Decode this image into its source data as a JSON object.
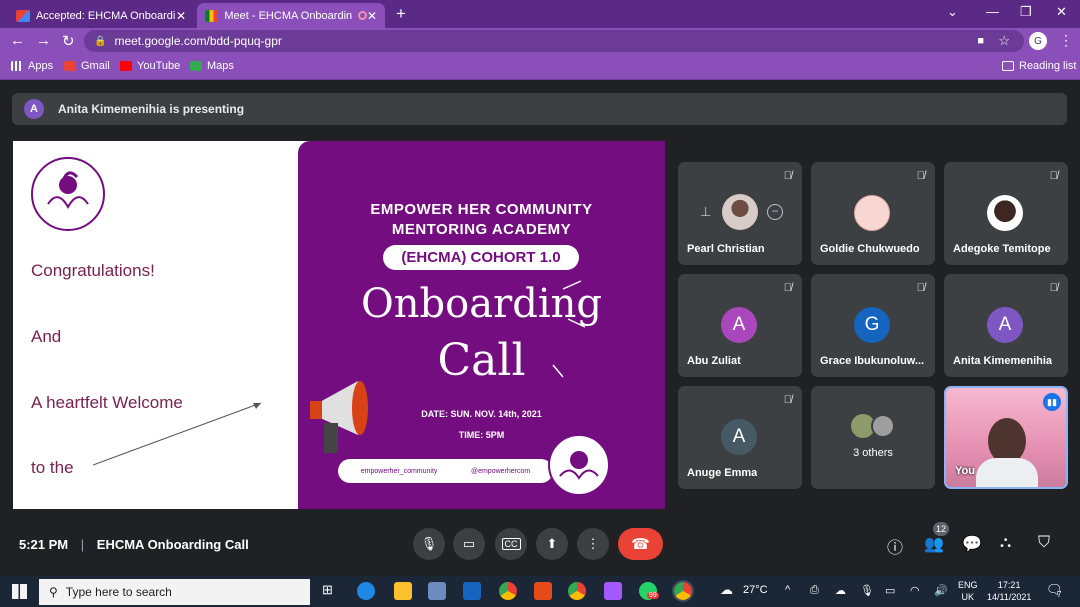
{
  "browser": {
    "tabs": [
      {
        "title": "Accepted: EHCMA Onboarding C",
        "favicon": "gmail-icon"
      },
      {
        "title": "Meet - EHCMA Onboarding",
        "favicon": "meet-icon"
      }
    ],
    "url": "meet.google.com/bdd-pquq-gpr",
    "bookmarks": [
      "Apps",
      "Gmail",
      "YouTube",
      "Maps"
    ],
    "reading_list": "Reading list",
    "profile_initial": "G"
  },
  "presenting": {
    "initial": "A",
    "text": "Anita Kimemenihia is presenting"
  },
  "slide": {
    "left_lines": [
      "Congratulations!",
      "And",
      "A heartfelt Welcome",
      "to the"
    ],
    "logo_text": "EMPOWER HER COMMUNITY",
    "poster_title_1": "EMPOWER HER COMMUNITY",
    "poster_title_2": "MENTORING ACADEMY",
    "cohort": "(EHCMA) COHORT 1.0",
    "script_1": "Onboarding",
    "script_2": "Call",
    "date": "DATE: SUN. NOV. 14th, 2021",
    "time": "TIME: 5PM",
    "social_1": "empowerher_community",
    "social_2": "@empowerhercom",
    "brand_color": "#740d80"
  },
  "participants": [
    {
      "name": "Pearl Christian",
      "avatar": "photo",
      "muted": true
    },
    {
      "name": "Goldie Chukwuedo",
      "avatar": "photo",
      "muted": true
    },
    {
      "name": "Adegoke Temitope",
      "avatar": "photo",
      "muted": true
    },
    {
      "name": "Abu Zuliat",
      "initial": "A",
      "color": "#ab47bc",
      "muted": true
    },
    {
      "name": "Grace Ibukunoluw...",
      "initial": "G",
      "color": "#1565c0",
      "muted": true
    },
    {
      "name": "Anita Kimemenihia",
      "initial": "A",
      "color": "#7e57c2",
      "muted": true
    },
    {
      "name": "Anuge Emma",
      "initial": "A",
      "color": "#455a64",
      "muted": true
    },
    {
      "name": "3 others",
      "avatar": "group"
    },
    {
      "name": "You",
      "avatar": "video",
      "speaking": true
    }
  ],
  "meeting": {
    "time": "5:21 PM",
    "title": "EHCMA Onboarding Call",
    "participant_count": "12"
  },
  "taskbar": {
    "search_placeholder": "Type here to search",
    "weather": "27°C",
    "lang": "ENG",
    "region": "UK",
    "clock_time": "17:21",
    "clock_date": "14/11/2021",
    "whatsapp_badge": "99",
    "notification_count": "7"
  }
}
